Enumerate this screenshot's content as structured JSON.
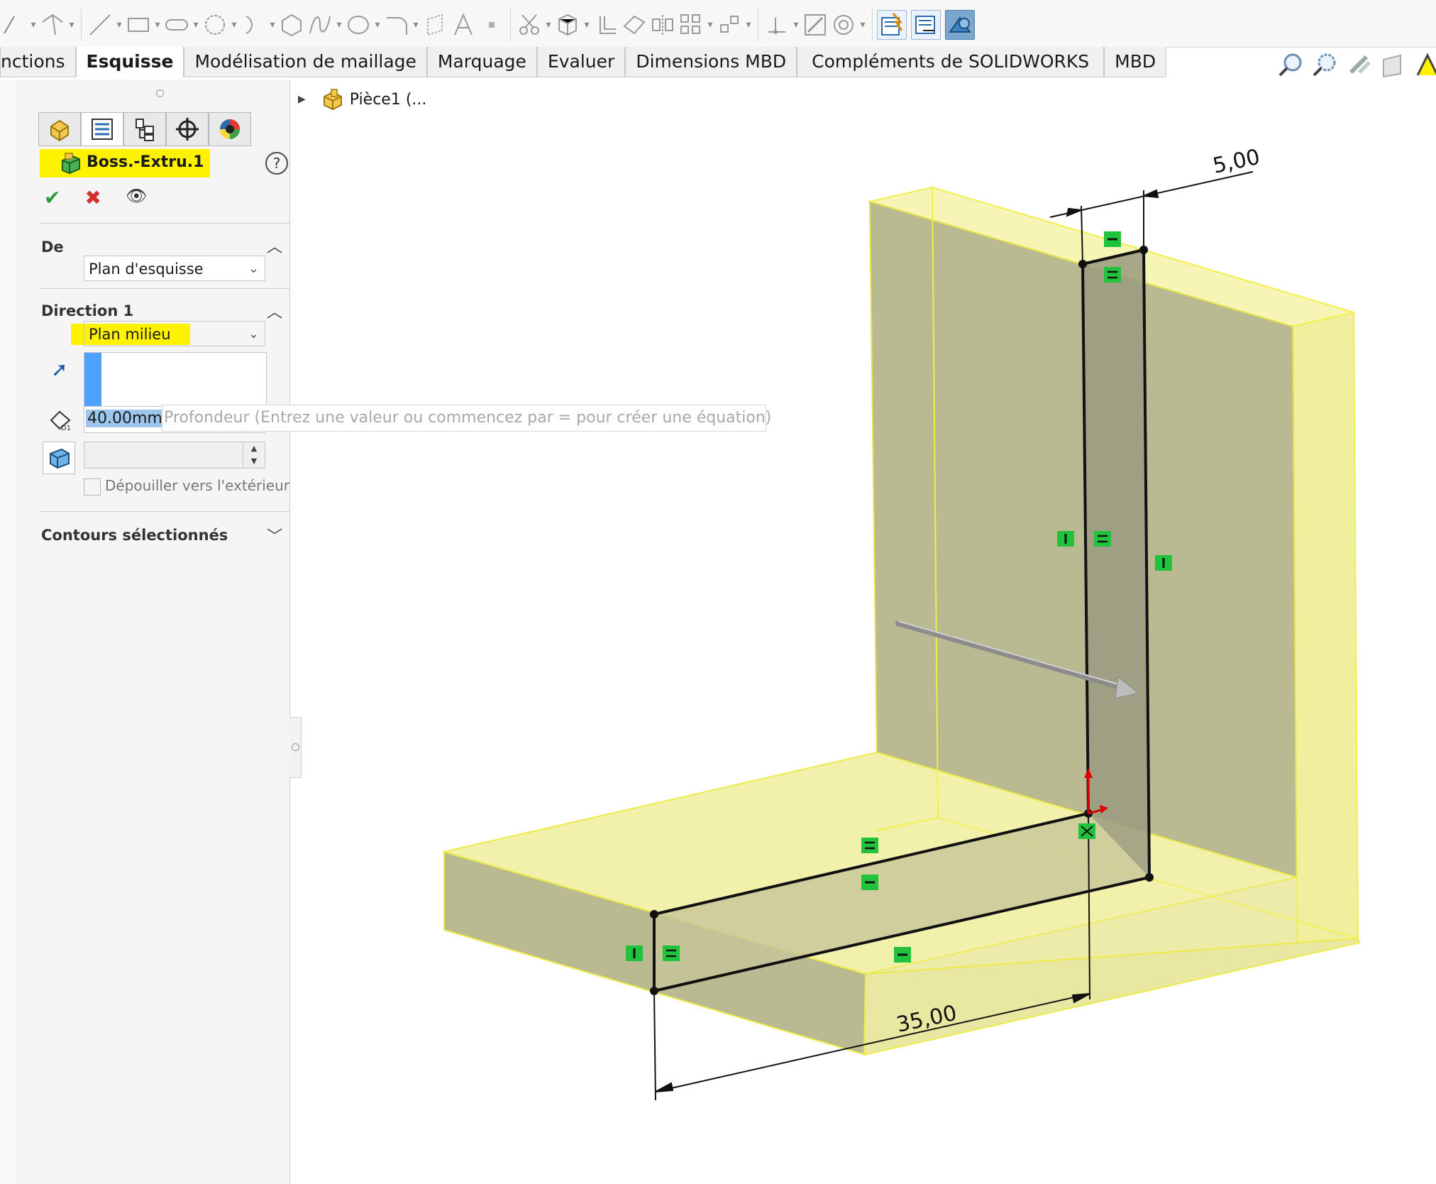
{
  "toolbar": {
    "icons": [
      "smart-dimension-icon",
      "line-icon",
      "rectangle-icon",
      "slot-icon",
      "circle-icon",
      "arc-icon",
      "polygon-icon",
      "spline-icon",
      "ellipse-icon",
      "fillet-icon",
      "plane-icon",
      "text-icon",
      "point-icon",
      "trim-icon",
      "convert-icon",
      "offset-icon",
      "mirror-icon",
      "linear-pattern-icon",
      "move-icon",
      "display-relations-icon",
      "repair-icon",
      "quick-snaps-icon",
      "rapid-sketch-icon",
      "instant2d-icon",
      "shaded-sketch-icon"
    ]
  },
  "tabs": {
    "fonctions": "nctions",
    "esquisse": "Esquisse",
    "maillage": "Modélisation de maillage",
    "marquage": "Marquage",
    "evaluer": "Evaluer",
    "dimensions_mbd": "Dimensions MBD",
    "complements": "Compléments de SOLIDWORKS",
    "mbd": "MBD"
  },
  "property_manager": {
    "title": "Boss.-Extru.1",
    "help": "?",
    "ok": "✔",
    "cancel": "✖",
    "preview": "👁",
    "section_de": "De",
    "de_value": "Plan d'esquisse",
    "section_direction": "Direction 1",
    "direction_value": "Plan milieu",
    "depth_value": "40.00mm",
    "draft_label": "Dépouiller vers l'extérieur",
    "section_contours": "Contours sélectionnés",
    "tooltip": "Profondeur (Entrez une valeur ou commencez par = pour créer une équation)"
  },
  "tree": {
    "root": "Pièce1 (..."
  },
  "viewport": {
    "dim_top": "5,00",
    "dim_bottom": "35,00",
    "highlight_color": "#fff200",
    "body_color": "#f1f0a8"
  }
}
